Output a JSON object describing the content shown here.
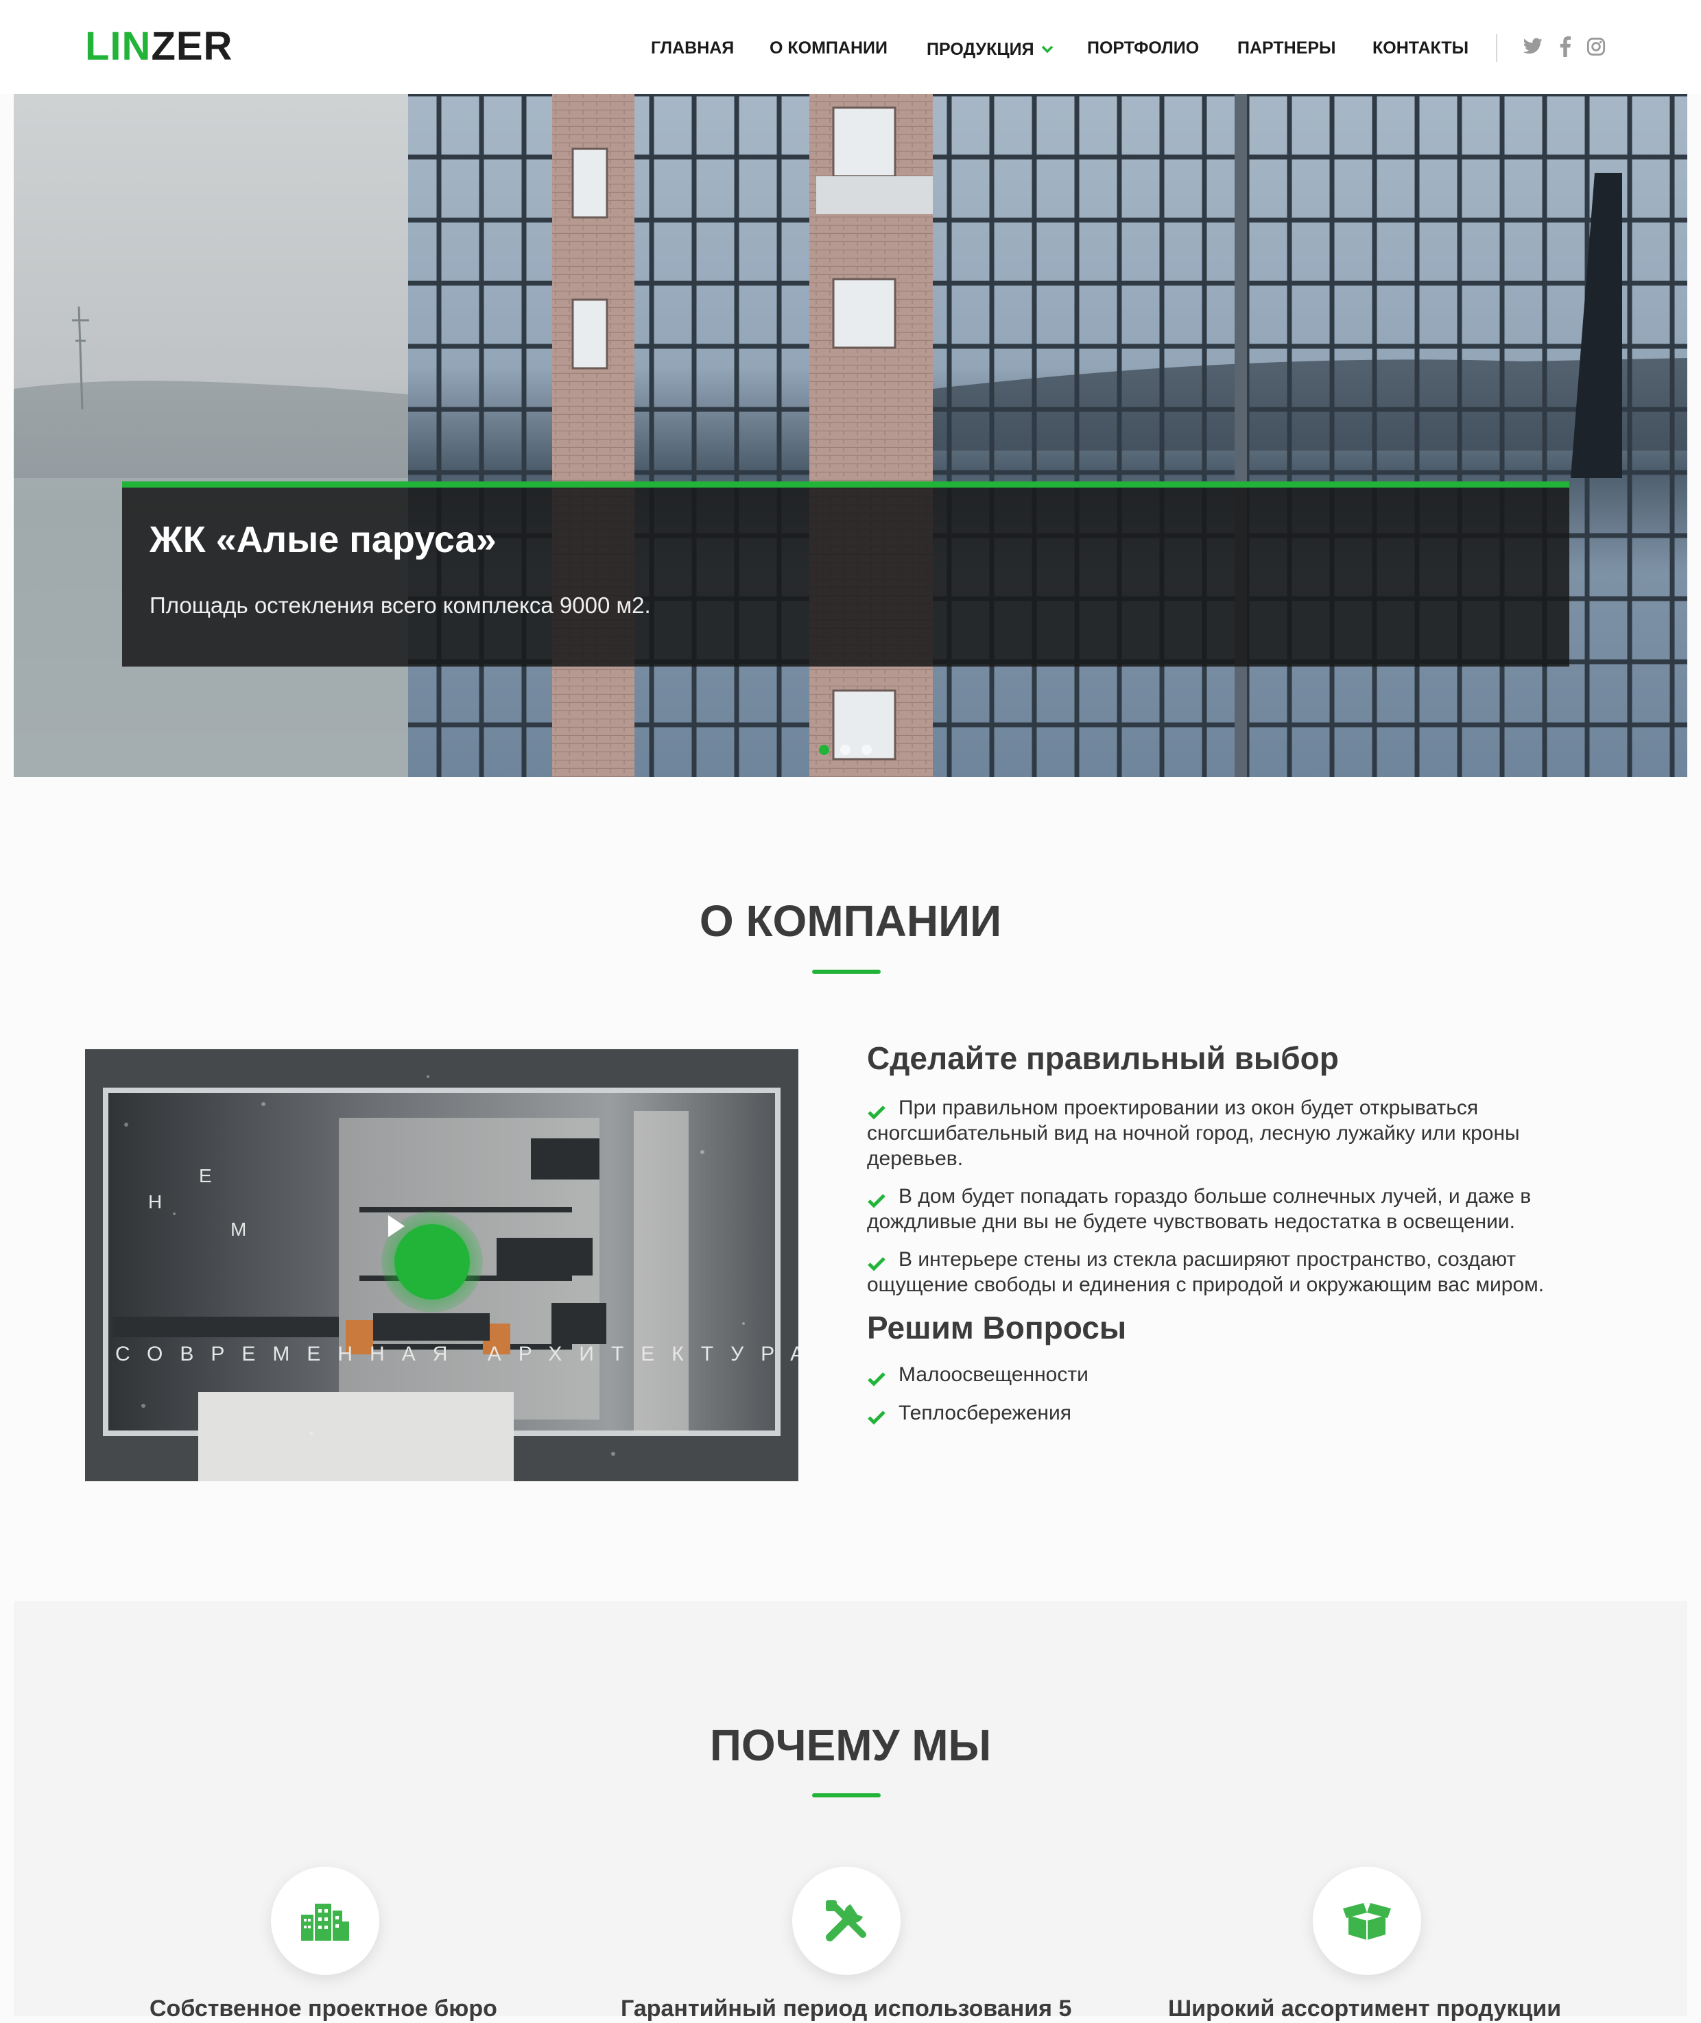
{
  "brand": {
    "logo_part1": "LIN",
    "logo_part2": "ZER",
    "accent_color": "#22b339"
  },
  "nav": {
    "items": [
      "ГЛАВНАЯ",
      "О КОМПАНИИ",
      "ПРОДУКЦИЯ",
      "ПОРТФОЛИО",
      "ПАРТНЕРЫ",
      "КОНТАКТЫ"
    ],
    "social": [
      "twitter-icon",
      "facebook-icon",
      "instagram-icon"
    ]
  },
  "hero": {
    "title": "ЖК «Алые паруса»",
    "text": "Площадь остекления всего комплекса 9000 м2.",
    "slides_count": 3,
    "active_slide": 1
  },
  "about": {
    "title": "О КОМПАНИИ",
    "video_overlay_letters": [
      "Н",
      "Е",
      "М"
    ],
    "video_overlay_text": "СОВРЕМЕННАЯ АРХИТЕКТУРА",
    "heading1": "Сделайте правильный выбор",
    "benefits": [
      "При правильном проектировании из окон будет открываться сногсшибательный вид на ночной город, лесную лужайку или кроны деревьев.",
      "В дом будет попадать гораздо больше солнечных лучей, и даже в дождливые дни вы не будете чувствовать недостатка в освещении.",
      "В интерьере стены из стекла расширяют пространство, создают ощущение свободы и единения с природой и окружающим вас миром."
    ],
    "heading2": "Решим Вопросы",
    "issues": [
      "Малоосвещенности",
      "Теплосбережения"
    ]
  },
  "why": {
    "title": "ПОЧЕМУ МЫ",
    "features": [
      {
        "icon": "building-icon",
        "title": "Собственное проектное бюро"
      },
      {
        "icon": "tools-icon",
        "title": "Гарантийный период использования 5"
      },
      {
        "icon": "box-icon",
        "title": "Широкий ассортимент продукции"
      }
    ]
  }
}
